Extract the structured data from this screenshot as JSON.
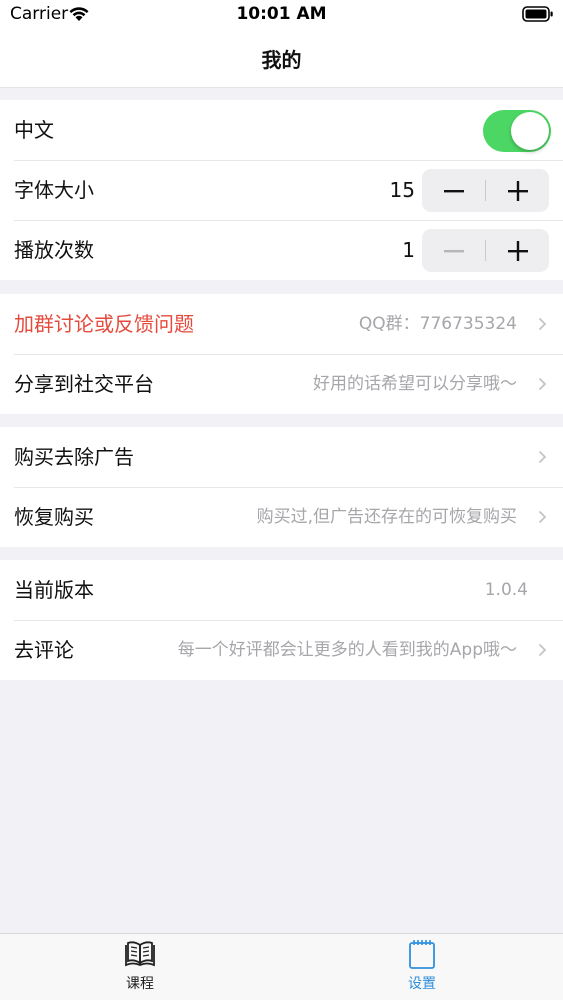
{
  "status_bar": {
    "carrier": "Carrier",
    "time": "10:01 AM"
  },
  "nav": {
    "title": "我的"
  },
  "settings": {
    "chinese": {
      "label": "中文",
      "toggle_on": true
    },
    "font_size": {
      "label": "字体大小",
      "value": "15"
    },
    "play_count": {
      "label": "播放次数",
      "value": "1"
    }
  },
  "links": {
    "join_group": {
      "label": "加群讨论或反馈问题",
      "detail": "QQ群：776735324"
    },
    "share": {
      "label": "分享到社交平台",
      "detail": "好用的话希望可以分享哦～"
    },
    "remove_ads": {
      "label": "购买去除广告"
    },
    "restore": {
      "label": "恢复购买",
      "detail": "购买过,但广告还存在的可恢复购买"
    },
    "version": {
      "label": "当前版本",
      "detail": "1.0.4"
    },
    "review": {
      "label": "去评论",
      "detail": "每一个好评都会让更多的人看到我的App哦～"
    }
  },
  "tabs": [
    {
      "label": "课程",
      "icon": "open-book-icon"
    },
    {
      "label": "设置",
      "icon": "notepad-icon"
    }
  ],
  "colors": {
    "accent": "#2f8fdc",
    "toggle_on": "#4cd764",
    "warning_text": "#e44b3d"
  }
}
